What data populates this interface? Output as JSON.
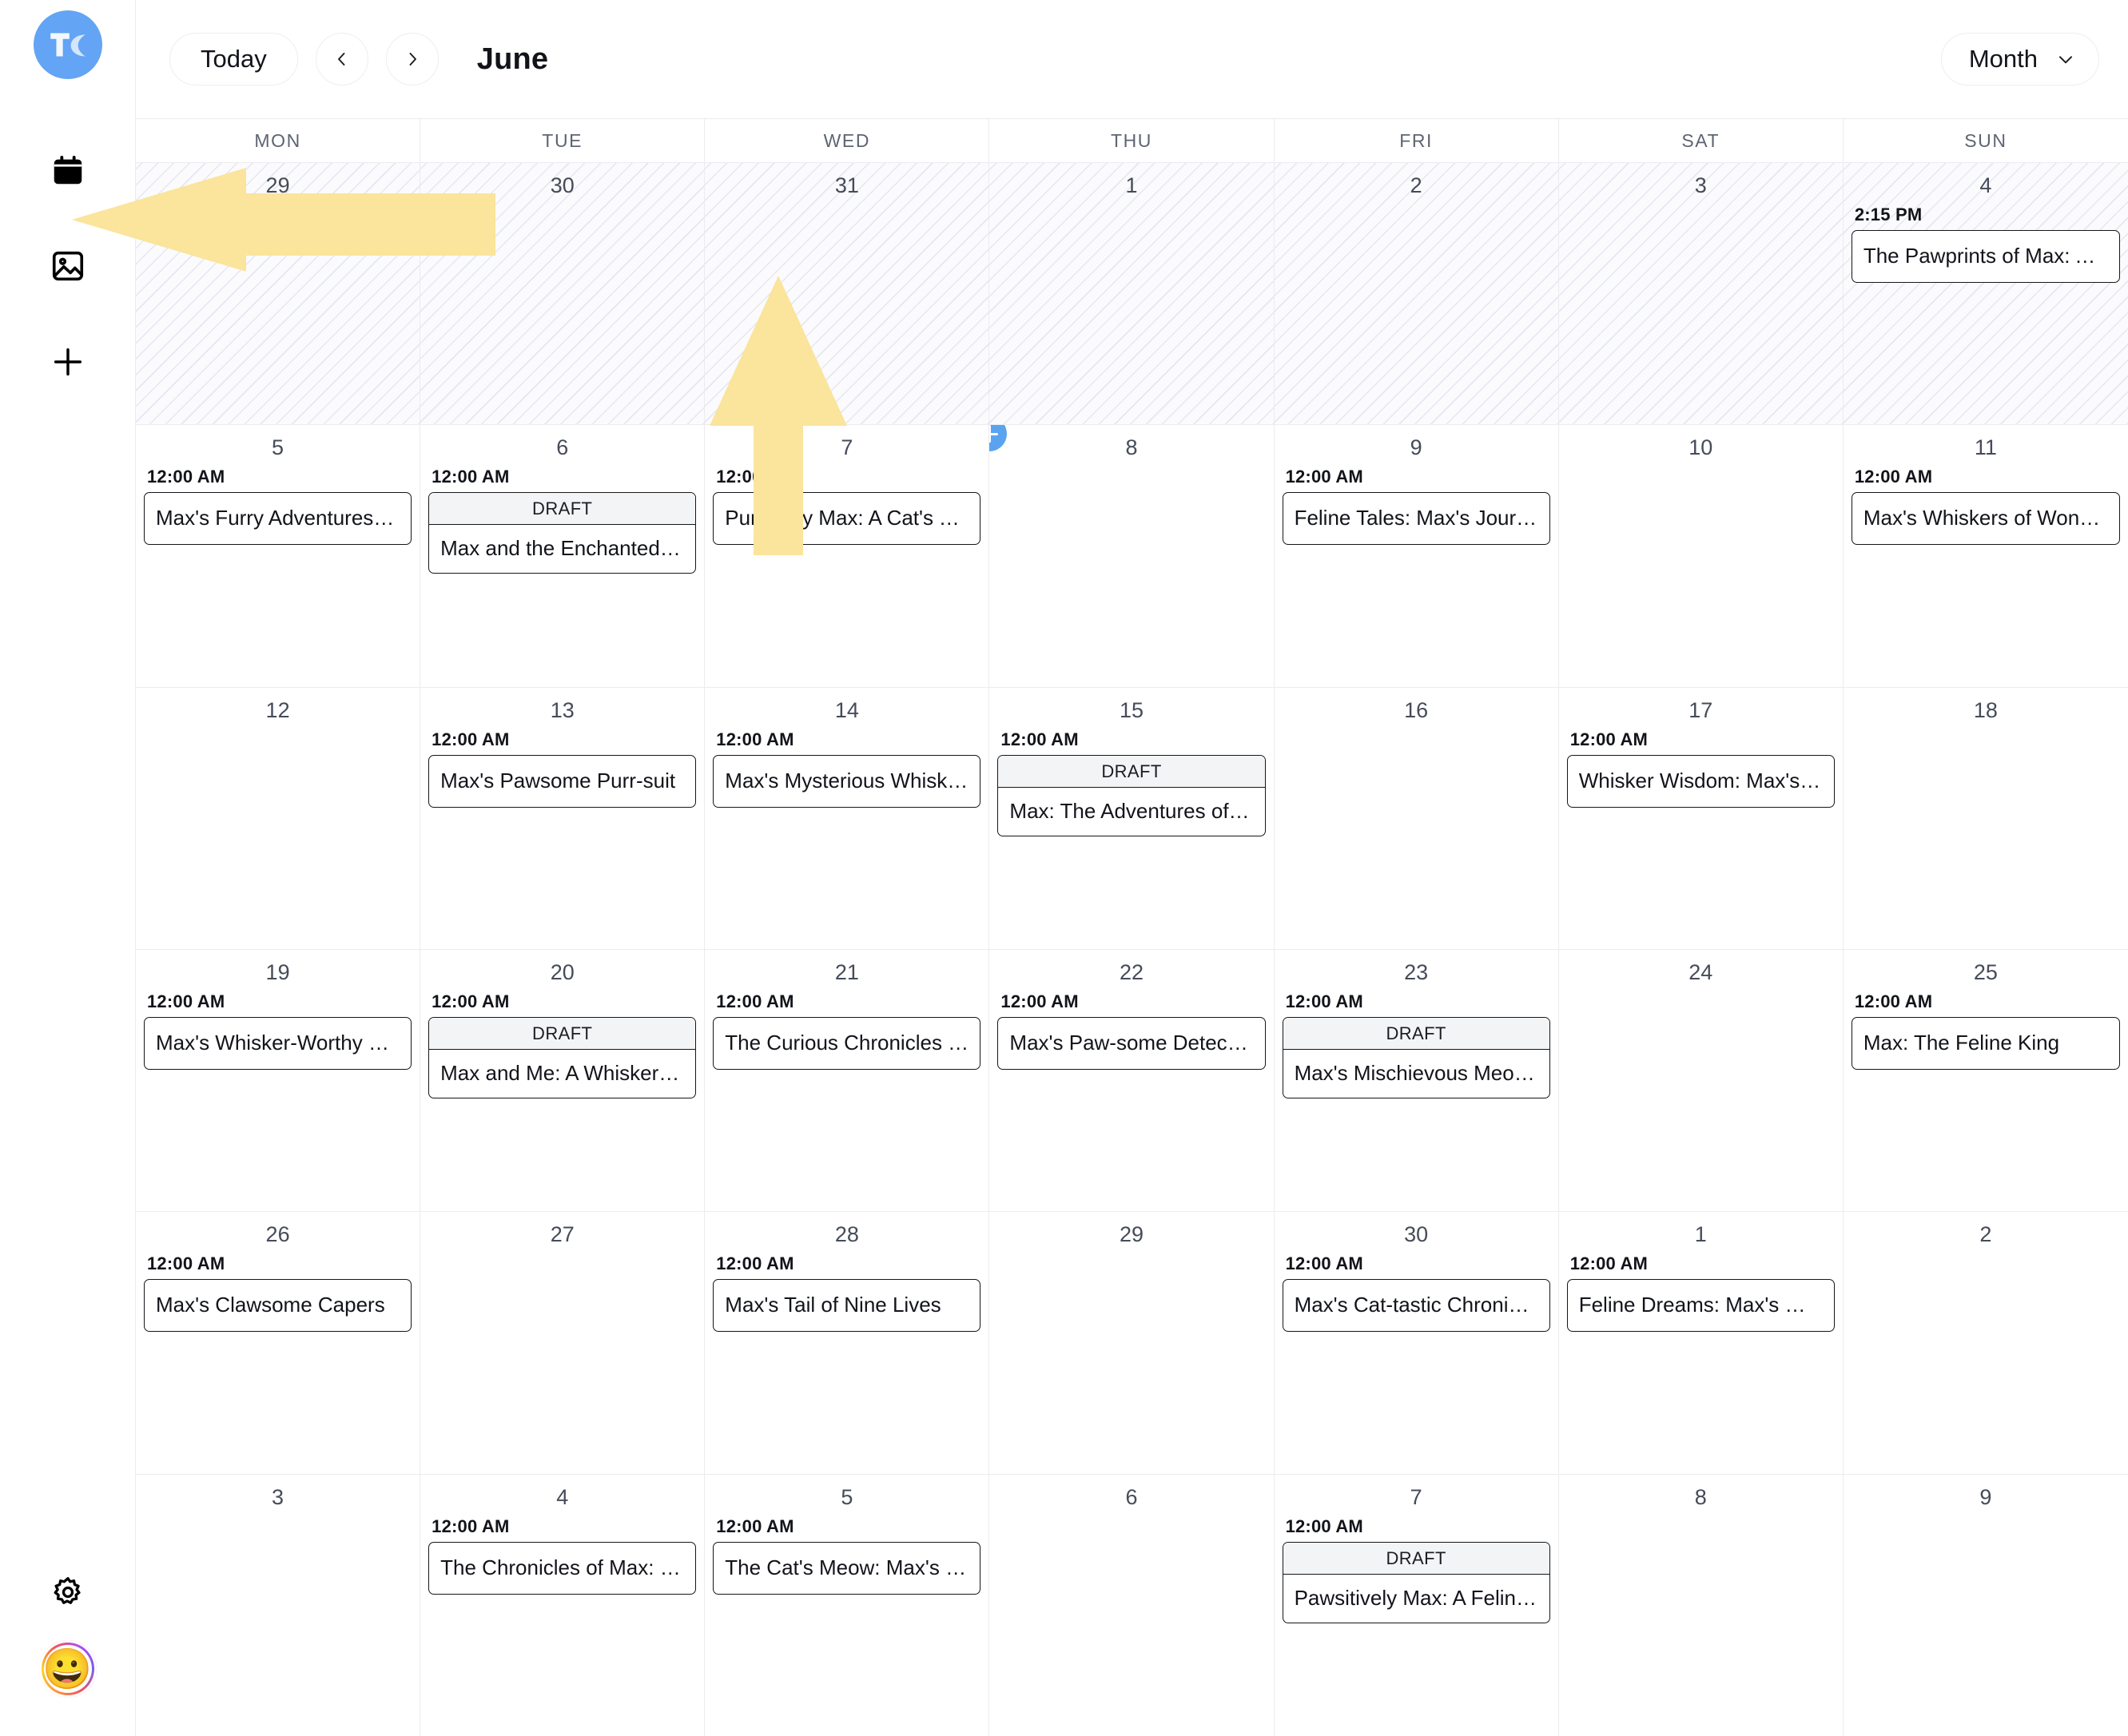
{
  "app": {
    "brand_icon": "tc-logo-icon"
  },
  "sidebar": {
    "items": [
      {
        "name": "calendar",
        "icon": "calendar-icon"
      },
      {
        "name": "media",
        "icon": "image-icon"
      },
      {
        "name": "create",
        "icon": "plus-icon"
      }
    ],
    "bottom": [
      {
        "name": "settings",
        "icon": "gear-icon"
      },
      {
        "name": "profile",
        "icon": "avatar-emoji",
        "glyph": "😀"
      }
    ]
  },
  "toolbar": {
    "today_label": "Today",
    "prev_icon": "chevron-left-icon",
    "next_icon": "chevron-right-icon",
    "month_title": "June",
    "view_label": "Month",
    "view_caret_icon": "chevron-down-icon"
  },
  "calendar": {
    "day_headers": [
      "MON",
      "TUE",
      "WED",
      "THU",
      "FRI",
      "SAT",
      "SUN"
    ],
    "draft_badge": "DRAFT",
    "default_time": "12:00 AM",
    "weeks": [
      {
        "days": [
          {
            "num": "29",
            "out": true,
            "events": []
          },
          {
            "num": "30",
            "out": true,
            "events": []
          },
          {
            "num": "31",
            "out": true,
            "events": []
          },
          {
            "num": "1",
            "out": true,
            "events": []
          },
          {
            "num": "2",
            "out": true,
            "events": []
          },
          {
            "num": "3",
            "out": true,
            "events": []
          },
          {
            "num": "4",
            "out": true,
            "events": [
              {
                "time": "2:15 PM",
                "title": "The Pawprints of Max: A C…",
                "draft": false
              }
            ]
          }
        ]
      },
      {
        "days": [
          {
            "num": "5",
            "out": false,
            "events": [
              {
                "time": "12:00 AM",
                "title": "Max's Furry Adventures: A …",
                "draft": false
              }
            ]
          },
          {
            "num": "6",
            "out": false,
            "events": [
              {
                "time": "12:00 AM",
                "title": "Max and the Enchanted Ya…",
                "draft": true
              }
            ]
          },
          {
            "num": "7",
            "out": false,
            "events": [
              {
                "time": "12:00 AM",
                "title": "Purrfectly Max: A Cat's Tale",
                "draft": false
              }
            ]
          },
          {
            "num": "8",
            "out": false,
            "add_button": true,
            "events": []
          },
          {
            "num": "9",
            "out": false,
            "events": [
              {
                "time": "12:00 AM",
                "title": "Feline Tales: Max's Journey",
                "draft": false
              }
            ]
          },
          {
            "num": "10",
            "out": false,
            "events": []
          },
          {
            "num": "11",
            "out": false,
            "events": [
              {
                "time": "12:00 AM",
                "title": "Max's Whiskers of Wonder",
                "draft": false
              }
            ]
          }
        ]
      },
      {
        "days": [
          {
            "num": "12",
            "out": false,
            "events": []
          },
          {
            "num": "13",
            "out": false,
            "events": [
              {
                "time": "12:00 AM",
                "title": "Max's Pawsome Purr-suit",
                "draft": false
              }
            ]
          },
          {
            "num": "14",
            "out": false,
            "events": [
              {
                "time": "12:00 AM",
                "title": "Max's Mysterious Whiskers",
                "draft": false
              }
            ]
          },
          {
            "num": "15",
            "out": false,
            "events": [
              {
                "time": "12:00 AM",
                "title": "Max: The Adventures of…",
                "draft": true
              }
            ]
          },
          {
            "num": "16",
            "out": false,
            "events": []
          },
          {
            "num": "17",
            "out": false,
            "events": [
              {
                "time": "12:00 AM",
                "title": "Whisker Wisdom: Max's Me…",
                "draft": false
              }
            ]
          },
          {
            "num": "18",
            "out": false,
            "events": []
          }
        ]
      },
      {
        "days": [
          {
            "num": "19",
            "out": false,
            "events": [
              {
                "time": "12:00 AM",
                "title": "Max's Whisker-Worthy Wo…",
                "draft": false
              }
            ]
          },
          {
            "num": "20",
            "out": false,
            "events": [
              {
                "time": "12:00 AM",
                "title": "Max and Me: A Whiskered …",
                "draft": true
              }
            ]
          },
          {
            "num": "21",
            "out": false,
            "events": [
              {
                "time": "12:00 AM",
                "title": "The Curious Chronicles of …",
                "draft": false
              }
            ]
          },
          {
            "num": "22",
            "out": false,
            "events": [
              {
                "time": "12:00 AM",
                "title": "Max's Paw-some Detectiv…",
                "draft": false
              }
            ]
          },
          {
            "num": "23",
            "out": false,
            "events": [
              {
                "time": "12:00 AM",
                "title": "Max's Mischievous Meows",
                "draft": true
              }
            ]
          },
          {
            "num": "24",
            "out": false,
            "events": []
          },
          {
            "num": "25",
            "out": false,
            "events": [
              {
                "time": "12:00 AM",
                "title": "Max: The Feline King",
                "draft": false
              }
            ]
          }
        ]
      },
      {
        "days": [
          {
            "num": "26",
            "out": false,
            "events": [
              {
                "time": "12:00 AM",
                "title": "Max's Clawsome Capers",
                "draft": false
              }
            ]
          },
          {
            "num": "27",
            "out": false,
            "events": []
          },
          {
            "num": "28",
            "out": false,
            "events": [
              {
                "time": "12:00 AM",
                "title": "Max's Tail of Nine Lives",
                "draft": false
              }
            ]
          },
          {
            "num": "29",
            "out": false,
            "events": []
          },
          {
            "num": "30",
            "out": false,
            "events": [
              {
                "time": "12:00 AM",
                "title": "Max's Cat-tastic Chronicles",
                "draft": false
              }
            ]
          },
          {
            "num": "1",
            "out": false,
            "events": [
              {
                "time": "12:00 AM",
                "title": "Feline Dreams: Max's Whis…",
                "draft": false
              }
            ]
          },
          {
            "num": "2",
            "out": false,
            "events": []
          }
        ]
      },
      {
        "days": [
          {
            "num": "3",
            "out": false,
            "events": []
          },
          {
            "num": "4",
            "out": false,
            "events": [
              {
                "time": "12:00 AM",
                "title": "The Chronicles of Max: Whi…",
                "draft": false
              }
            ]
          },
          {
            "num": "5",
            "out": false,
            "events": [
              {
                "time": "12:00 AM",
                "title": "The Cat's Meow: Max's Feli…",
                "draft": false
              }
            ]
          },
          {
            "num": "6",
            "out": false,
            "events": []
          },
          {
            "num": "7",
            "out": false,
            "events": [
              {
                "time": "12:00 AM",
                "title": "Pawsitively Max: A Feline's …",
                "draft": true
              }
            ]
          },
          {
            "num": "8",
            "out": false,
            "events": []
          },
          {
            "num": "9",
            "out": false,
            "events": []
          }
        ]
      }
    ]
  },
  "annotations": [
    {
      "name": "left-arrow-annotation",
      "direction": "left"
    },
    {
      "name": "up-arrow-annotation",
      "direction": "up"
    }
  ],
  "colors": {
    "brand_blue": "#63a4f4",
    "add_button_blue": "#5aa3f0",
    "annotation_yellow": "#fbe49b",
    "grid_line": "#ececef",
    "out_of_month_bg": "#fbfbfd",
    "draft_bar_bg": "#f3f4f6",
    "text_primary": "#12141a",
    "text_muted": "#5e6472"
  }
}
